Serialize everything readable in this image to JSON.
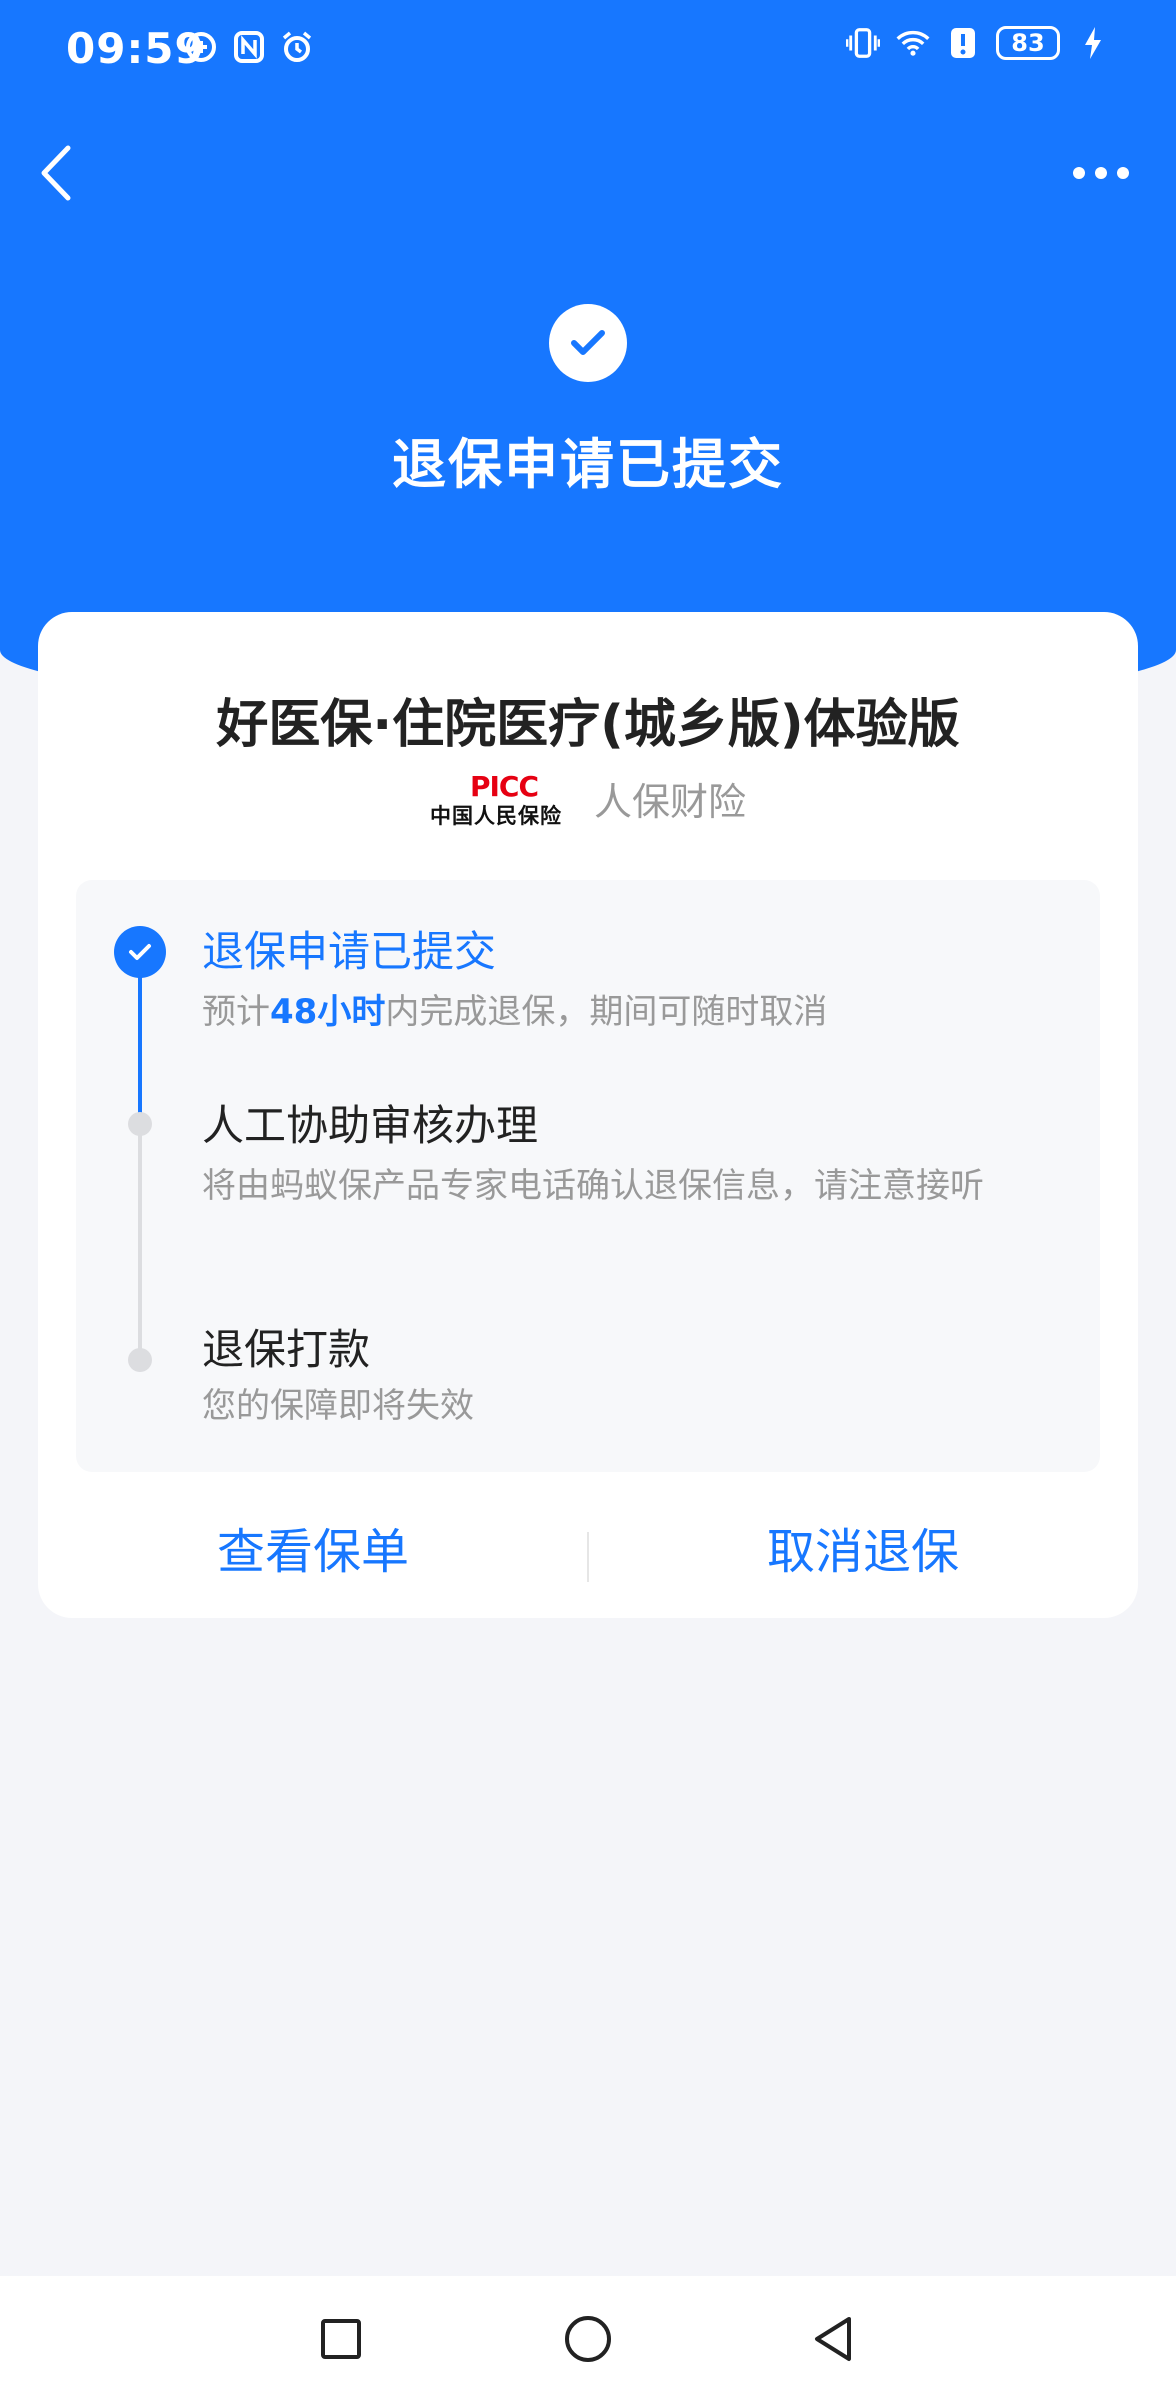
{
  "status_bar": {
    "time": "09:59",
    "battery": "83"
  },
  "header": {
    "title": "退保申请已提交"
  },
  "product": {
    "name": "好医保·住院医疗(城乡版)体验版",
    "insurer_logo_top": "PICC",
    "insurer_logo_bottom": "中国人民保险",
    "insurer_name": "人保财险"
  },
  "timeline": [
    {
      "title": "退保申请已提交",
      "desc_prefix": "预计",
      "desc_highlight": "48小时",
      "desc_suffix": "内完成退保，期间可随时取消",
      "status": "done"
    },
    {
      "title": "人工协助审核办理",
      "desc": "将由蚂蚁保产品专家电话确认退保信息，请注意接听",
      "status": "pending"
    },
    {
      "title": "退保打款",
      "desc": "您的保障即将失效",
      "status": "pending"
    }
  ],
  "actions": {
    "view_policy": "查看保单",
    "cancel_surrender": "取消退保"
  },
  "colors": {
    "primary": "#1777ff",
    "background": "#f4f5f9"
  }
}
